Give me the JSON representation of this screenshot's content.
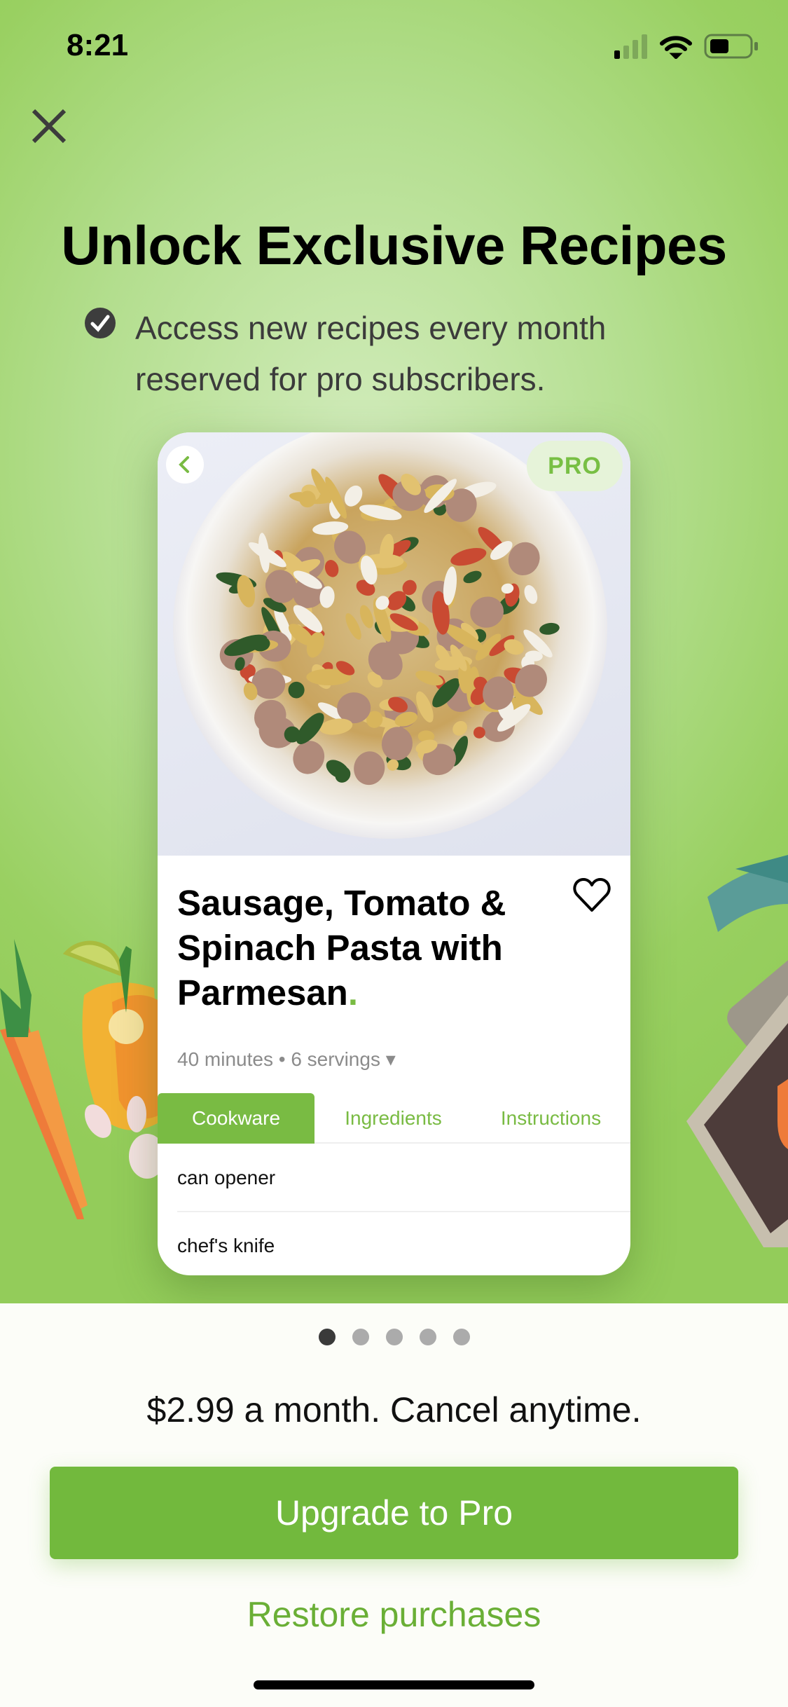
{
  "status_bar": {
    "time": "8:21",
    "icons": [
      "signal-icon",
      "wifi-icon",
      "battery-icon"
    ]
  },
  "header": {
    "close_icon": "close-icon",
    "title": "Unlock Exclusive Recipes"
  },
  "features": [
    {
      "icon": "check-circle-icon",
      "line1": "Access new recipes every month",
      "line2": "reserved for pro subscribers."
    }
  ],
  "preview_card": {
    "badge": "PRO",
    "title_line1": "Sausage, Tomato &",
    "title_line2": "Spinach Pasta with",
    "title_line3": "Parmesan",
    "title_dot": ".",
    "meta": "40 minutes • 6 servings ▾",
    "tabs": [
      {
        "label": "Cookware",
        "active": true
      },
      {
        "label": "Ingredients",
        "active": false
      },
      {
        "label": "Instructions",
        "active": false
      }
    ],
    "items": [
      "can opener",
      "chef's knife"
    ]
  },
  "pager": {
    "count": 5,
    "active_index": 0
  },
  "pricing": {
    "text": "$2.99 a month. Cancel anytime."
  },
  "actions": {
    "upgrade_label": "Upgrade to Pro",
    "restore_label": "Restore purchases"
  },
  "colors": {
    "accent": "#72b93d",
    "tab_green": "#79bb43",
    "link_green": "#6aaf36",
    "hero_bg": "#a8d87a"
  }
}
